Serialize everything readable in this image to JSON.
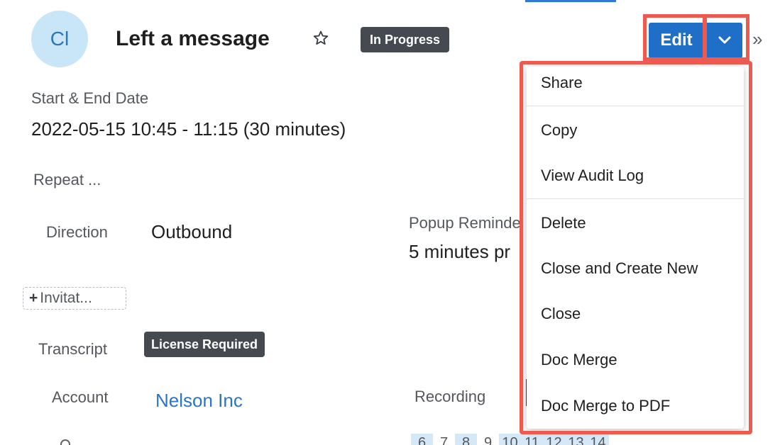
{
  "header": {
    "avatar_initials": "Cl",
    "record_title": "Left a message",
    "status_badge": "In Progress",
    "edit_button_label": "Edit",
    "expand_glyph": "»"
  },
  "fields": {
    "start_end_label": "Start & End Date",
    "start_end_value": "2022-05-15 10:45 - 11:15 (30 minutes)",
    "repeat_label": "Repeat ...",
    "direction_label": "Direction",
    "direction_value": "Outbound",
    "popup_reminder_label": "Popup Reminde",
    "popup_reminder_value": "5 minutes pr",
    "invitees_button_label": "Invitat...",
    "transcript_label": "Transcript",
    "transcript_badge": "License Required",
    "account_label": "Account",
    "account_value": "Nelson Inc",
    "recording_label": "Recording"
  },
  "calendar_strip": {
    "days": [
      "6",
      "7",
      "8",
      "9",
      "10",
      "11",
      "12",
      "13",
      "14"
    ],
    "highlighted": [
      "6",
      "8",
      "10",
      "11",
      "12",
      "13",
      "14"
    ]
  },
  "dropdown_menu": {
    "items": [
      "Share",
      "Copy",
      "View Audit Log",
      "Delete",
      "Close and Create New",
      "Close",
      "Doc Merge",
      "Doc Merge to PDF"
    ]
  },
  "colors": {
    "primary_button": "#1f6ec8",
    "highlight_border": "#ef5a50",
    "badge_background": "#444a50",
    "link": "#2a75c6",
    "avatar_background": "#c8e6f8"
  },
  "icons": [
    "star-icon",
    "chevron-down-icon",
    "double-chevron-right-icon",
    "plus-icon"
  ]
}
